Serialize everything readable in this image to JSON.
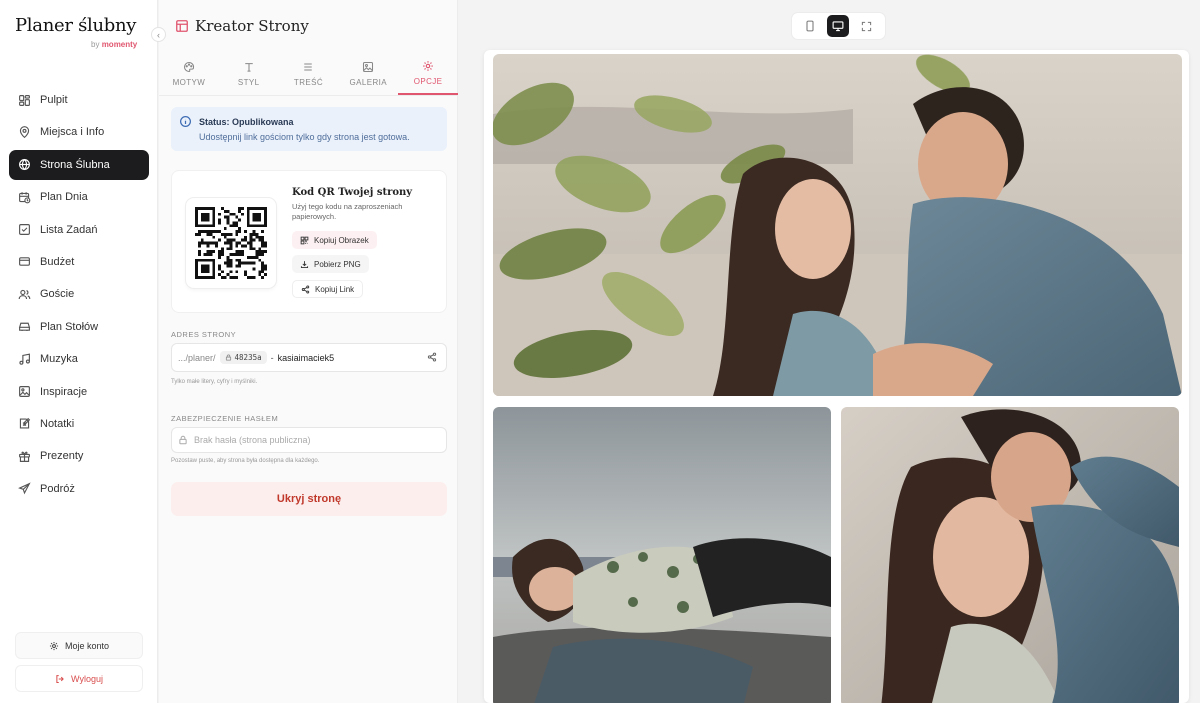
{
  "brand": {
    "title": "Planer ślubny",
    "by": "by",
    "by_brand": "momenty",
    "collapse_symbol": "‹"
  },
  "sidebar": {
    "items": [
      {
        "label": "Pulpit",
        "icon": "dashboard-icon"
      },
      {
        "label": "Miejsca i Info",
        "icon": "map-pin-icon"
      },
      {
        "label": "Strona Ślubna",
        "icon": "globe-icon",
        "active": true
      },
      {
        "label": "Plan Dnia",
        "icon": "calendar-clock-icon"
      },
      {
        "label": "Lista Zadań",
        "icon": "checklist-icon"
      },
      {
        "label": "Budżet",
        "icon": "wallet-icon"
      },
      {
        "label": "Goście",
        "icon": "users-icon"
      },
      {
        "label": "Plan Stołów",
        "icon": "table-icon"
      },
      {
        "label": "Muzyka",
        "icon": "music-icon"
      },
      {
        "label": "Inspiracje",
        "icon": "image-icon"
      },
      {
        "label": "Notatki",
        "icon": "notes-icon"
      },
      {
        "label": "Prezenty",
        "icon": "gift-icon"
      },
      {
        "label": "Podróż",
        "icon": "plane-icon"
      }
    ],
    "account_label": "Moje konto",
    "logout_label": "Wyloguj"
  },
  "editor": {
    "title": "Kreator Strony",
    "tabs": [
      {
        "label": "MOTYW",
        "icon": "palette-icon"
      },
      {
        "label": "STYL",
        "icon": "type-icon"
      },
      {
        "label": "TREŚĆ",
        "icon": "text-lines-icon"
      },
      {
        "label": "GALERIA",
        "icon": "gallery-icon"
      },
      {
        "label": "OPCJE",
        "icon": "gear-icon",
        "active": true
      }
    ],
    "status": {
      "title": "Status: Opublikowana",
      "description": "Udostępnij link gościom tylko gdy strona jest gotowa."
    },
    "qr": {
      "title": "Kod QR Twojej strony",
      "description": "Użyj tego kodu na zaproszeniach papierowych.",
      "copy_image_label": "Kopiuj Obrazek",
      "download_png_label": "Pobierz PNG",
      "copy_link_label": "Kopiuj Link"
    },
    "address": {
      "section_label": "ADRES STRONY",
      "prefix": ".../planer/",
      "code": "48235a",
      "separator": "-",
      "slug": "kasiaimaciek5",
      "hint": "Tylko małe litery, cyfry i myślniki."
    },
    "password": {
      "section_label": "ZABEZPIECZENIE HASŁEM",
      "placeholder": "Brak hasła (strona publiczna)",
      "hint": "Pozostaw puste, aby strona była dostępna dla każdego."
    },
    "hide_button_label": "Ukryj stronę"
  },
  "preview": {
    "devices": [
      {
        "icon": "mobile-icon"
      },
      {
        "icon": "desktop-icon",
        "active": true
      },
      {
        "icon": "fullscreen-icon"
      }
    ],
    "colors": {
      "accent": "#e0566f",
      "sidebar_active": "#1c1c1e"
    }
  }
}
